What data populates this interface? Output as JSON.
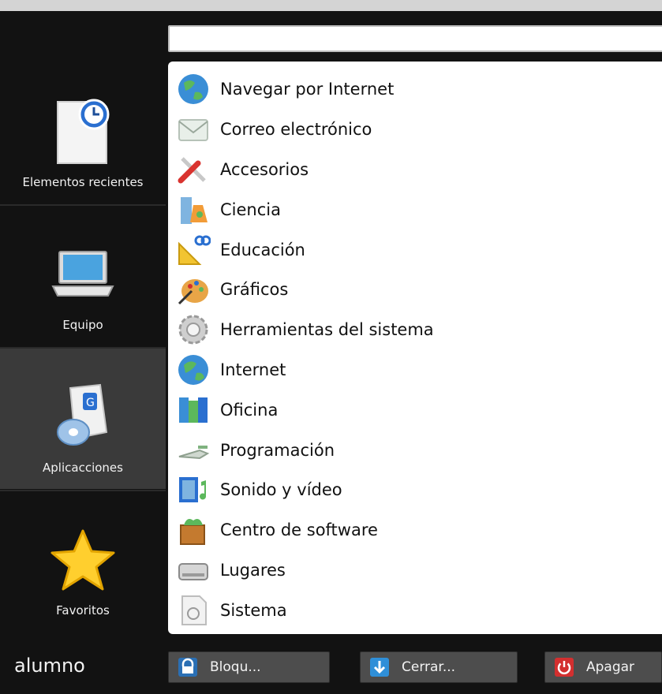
{
  "search": {
    "value": "",
    "placeholder": ""
  },
  "sidebar": {
    "items": [
      {
        "label": "Elementos recientes",
        "icon": "recent-documents-icon"
      },
      {
        "label": "Equipo",
        "icon": "laptop-icon"
      },
      {
        "label": "Aplicacciones",
        "icon": "applications-icon"
      },
      {
        "label": "Favoritos",
        "icon": "star-icon"
      }
    ]
  },
  "apps": [
    {
      "label": "Navegar por Internet",
      "icon": "web-browser-icon"
    },
    {
      "label": "Correo electrónico",
      "icon": "mail-icon"
    },
    {
      "label": "Accesorios",
      "icon": "accessories-icon"
    },
    {
      "label": "Ciencia",
      "icon": "science-icon"
    },
    {
      "label": "Educación",
      "icon": "education-icon"
    },
    {
      "label": "Gráficos",
      "icon": "graphics-icon"
    },
    {
      "label": "Herramientas del sistema",
      "icon": "system-tools-icon"
    },
    {
      "label": "Internet",
      "icon": "internet-icon"
    },
    {
      "label": "Oficina",
      "icon": "office-icon"
    },
    {
      "label": "Programación",
      "icon": "programming-icon"
    },
    {
      "label": "Sonido y vídeo",
      "icon": "sound-video-icon"
    },
    {
      "label": "Centro de software",
      "icon": "software-center-icon"
    },
    {
      "label": "Lugares",
      "icon": "places-icon"
    },
    {
      "label": "Sistema",
      "icon": "system-icon"
    }
  ],
  "bottom": {
    "user": "alumno",
    "lock_label": "Bloqu...",
    "logout_label": "Cerrar...",
    "shutdown_label": "Apagar"
  },
  "colors": {
    "background": "#121212",
    "active_item": "#3a3a3a",
    "panel": "#ffffff",
    "button": "#4d4d4d",
    "lock_icon": "#2a6fb4",
    "logout_icon": "#2f8fd8",
    "shutdown_icon": "#d32f2f"
  }
}
